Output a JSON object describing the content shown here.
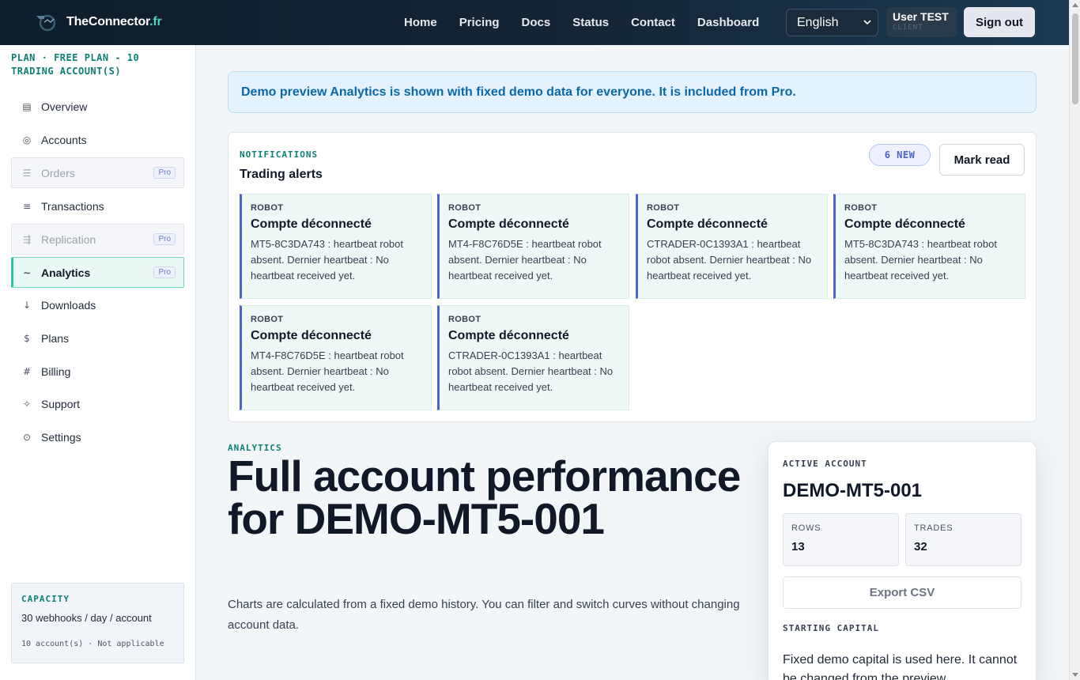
{
  "brand": {
    "name": "TheConnector",
    "tld": ".fr"
  },
  "nav": [
    "Home",
    "Pricing",
    "Docs",
    "Status",
    "Contact",
    "Dashboard"
  ],
  "language": {
    "selected": "English"
  },
  "user": {
    "name": "User TEST",
    "role": "CLIENT"
  },
  "sign_out": "Sign out",
  "sidebar": {
    "plan": "PLAN · FREE PLAN - 10 TRADING ACCOUNT(S)",
    "items": [
      {
        "label": "Overview",
        "icon": "▤"
      },
      {
        "label": "Accounts",
        "icon": "◎"
      },
      {
        "label": "Orders",
        "icon": "☰",
        "badge": "Pro"
      },
      {
        "label": "Transactions",
        "icon": "≡"
      },
      {
        "label": "Replication",
        "icon": "⇶",
        "badge": "Pro"
      },
      {
        "label": "Analytics",
        "icon": "∼",
        "badge": "Pro"
      },
      {
        "label": "Downloads",
        "icon": "↓"
      },
      {
        "label": "Plans",
        "icon": "$"
      },
      {
        "label": "Billing",
        "icon": "#"
      },
      {
        "label": "Support",
        "icon": "✧"
      },
      {
        "label": "Settings",
        "icon": "⊙"
      }
    ],
    "capacity": {
      "title": "CAPACITY",
      "value": "30 webhooks / day / account",
      "footer": "10 account(s) · Not applicable"
    }
  },
  "banner": "Demo preview Analytics is shown with fixed demo data for everyone. It is included from Pro.",
  "notifications": {
    "kicker": "NOTIFICATIONS",
    "title": "Trading alerts",
    "new_badge": "6 NEW",
    "mark_read": "Mark read",
    "cards": [
      {
        "source": "ROBOT",
        "title": "Compte déconnecté",
        "body": "MT5-8C3DA743 : heartbeat robot absent. Dernier heartbeat : No heartbeat received yet."
      },
      {
        "source": "ROBOT",
        "title": "Compte déconnecté",
        "body": "MT4-F8C76D5E : heartbeat robot absent. Dernier heartbeat : No heartbeat received yet."
      },
      {
        "source": "ROBOT",
        "title": "Compte déconnecté",
        "body": "CTRADER-0C1393A1 : heartbeat robot absent. Dernier heartbeat : No heartbeat received yet."
      },
      {
        "source": "ROBOT",
        "title": "Compte déconnecté",
        "body": "MT5-8C3DA743 : heartbeat robot absent. Dernier heartbeat : No heartbeat received yet."
      },
      {
        "source": "ROBOT",
        "title": "Compte déconnecté",
        "body": "MT4-F8C76D5E : heartbeat robot absent. Dernier heartbeat : No heartbeat received yet."
      },
      {
        "source": "ROBOT",
        "title": "Compte déconnecté",
        "body": "CTRADER-0C1393A1 : heartbeat robot absent. Dernier heartbeat : No heartbeat received yet."
      }
    ]
  },
  "analytics": {
    "kicker": "ANALYTICS",
    "title": "Full account performance for DEMO-MT5-001",
    "subtitle": "Charts are calculated from a fixed demo history. You can filter and switch curves without changing account data."
  },
  "active_account": {
    "kicker": "ACTIVE ACCOUNT",
    "name": "DEMO-MT5-001",
    "rows_label": "ROWS",
    "rows_value": "13",
    "trades_label": "TRADES",
    "trades_value": "32",
    "export_label": "Export CSV",
    "capital_kicker": "STARTING CAPITAL",
    "capital_text": "Fixed demo capital is used here. It cannot be changed from the preview."
  },
  "colors": {
    "accent": "#33c1ae",
    "nav_bg": "#0e1d2b",
    "pro": "#4d63c9",
    "banner": "#0b68a8"
  }
}
